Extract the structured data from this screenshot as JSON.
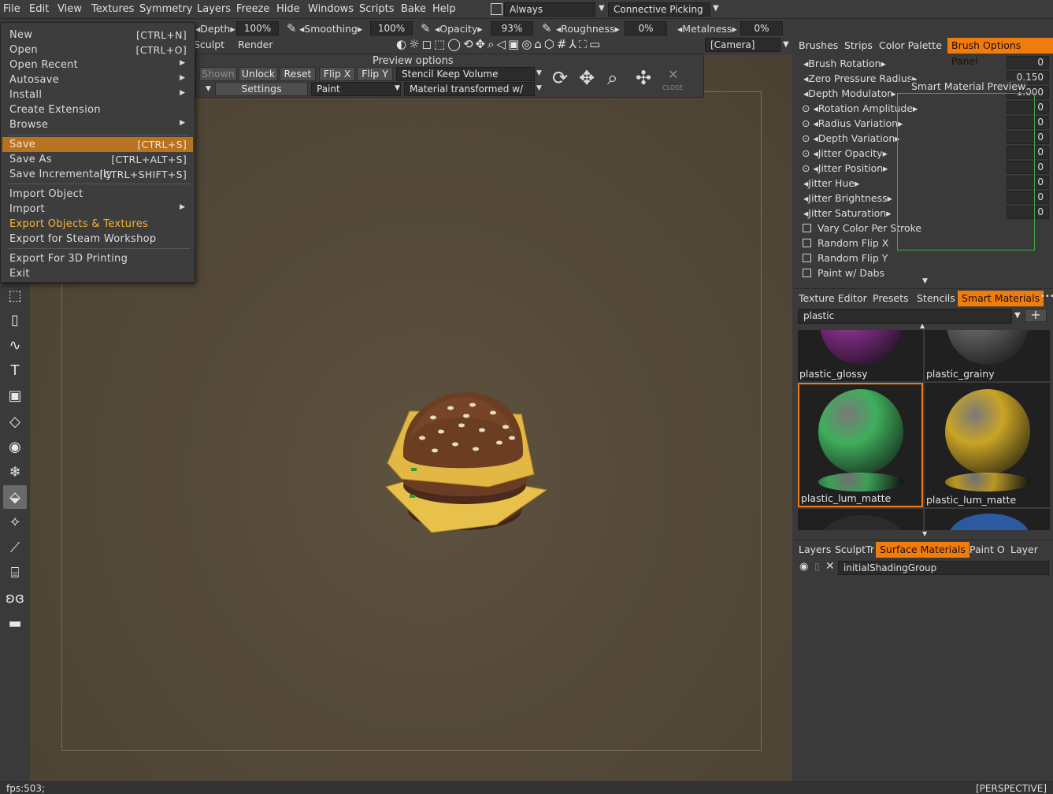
{
  "menubar": {
    "items": [
      "File",
      "Edit",
      "View",
      "Textures",
      "Symmetry",
      "Layers",
      "Freeze",
      "Hide",
      "Windows",
      "Scripts",
      "Bake",
      "Help"
    ],
    "always_label": "Always",
    "picking_label": "Connective Picking"
  },
  "toolbar": {
    "depth_label": "Depth",
    "depth_value": "100%",
    "smoothing_label": "Smoothing",
    "smoothing_value": "100%",
    "opacity_label": "Opacity",
    "opacity_value": "93%",
    "roughness_label": "Roughness",
    "roughness_value": "0%",
    "metalness_label": "Metalness",
    "metalness_value": "0%",
    "room_tabs": [
      "Sculpt",
      "Render"
    ],
    "camera_label": "[Camera]"
  },
  "file_menu": {
    "items": [
      {
        "label": "New",
        "shortcut": "[CTRL+N]"
      },
      {
        "label": "Open",
        "shortcut": "[CTRL+O]"
      },
      {
        "label": "Open Recent",
        "shortcut": ""
      },
      {
        "label": "Autosave",
        "shortcut": ""
      },
      {
        "label": "Install",
        "shortcut": ""
      },
      {
        "label": "Create Extension",
        "shortcut": ""
      },
      {
        "label": "Browse",
        "shortcut": ""
      },
      {
        "label": "Save",
        "shortcut": "[CTRL+S]"
      },
      {
        "label": "Save As",
        "shortcut": "[CTRL+ALT+S]"
      },
      {
        "label": "Save Incrementally",
        "shortcut": "[CTRL+SHIFT+S]"
      },
      {
        "label": "Import Object",
        "shortcut": ""
      },
      {
        "label": "Import",
        "shortcut": ""
      },
      {
        "label": "Export Objects & Textures",
        "shortcut": ""
      },
      {
        "label": "Export for Steam Workshop",
        "shortcut": ""
      },
      {
        "label": "Export For 3D Printing",
        "shortcut": ""
      },
      {
        "label": "Exit",
        "shortcut": ""
      }
    ]
  },
  "preview_options": {
    "title": "Preview options",
    "buttons": [
      "Shown",
      "Unlock",
      "Reset",
      "Flip X",
      "Flip Y"
    ],
    "stencil_mode": "Stencil Keep Volume",
    "settings_label": "Settings",
    "paint_label": "Paint",
    "material_mode": "Material transformed w/",
    "close_label": "CLOSE"
  },
  "brush_panel": {
    "tabs": [
      "Brushes",
      "Strips",
      "Color Palette",
      "Brush Options Panel"
    ],
    "active_tab": "Brush Options Panel",
    "smart_preview_label": "Smart Material Preview",
    "rows": [
      {
        "label": "Brush Rotation",
        "value": "0"
      },
      {
        "label": "Zero Pressure Radius",
        "value": "0.150"
      },
      {
        "label": "Depth Modulator",
        "value": "1.000"
      },
      {
        "label": "Rotation Amplitude",
        "value": "0"
      },
      {
        "label": "Radius Variation",
        "value": "0"
      },
      {
        "label": "Depth Variation",
        "value": "0"
      },
      {
        "label": "Jitter Opacity",
        "value": "0"
      },
      {
        "label": "Jitter Position",
        "value": "0"
      },
      {
        "label": "Jitter Hue",
        "value": "0"
      },
      {
        "label": "Jitter Brightness",
        "value": "0"
      },
      {
        "label": "Jitter Saturation",
        "value": "0"
      }
    ],
    "checkboxes": [
      "Vary Color Per Stroke",
      "Random Flip X",
      "Random Flip Y",
      "Paint w/ Dabs"
    ]
  },
  "smart_materials": {
    "tabs": [
      "Texture Editor",
      "Presets",
      "Stencils",
      "Smart Materials"
    ],
    "active_tab": "Smart Materials",
    "search_value": "plastic",
    "items": [
      {
        "name": "plastic_glossy",
        "color": "#7a2a7e"
      },
      {
        "name": "plastic_grainy",
        "color": "#5a5a5a"
      },
      {
        "name": "plastic_lum_matte",
        "color": "#3fae5c"
      },
      {
        "name": "plastic_lum_matte",
        "color": "#c9a425"
      }
    ]
  },
  "layers_panel": {
    "tabs": [
      "Layers",
      "SculptTr",
      "Surface Materials",
      "Paint O",
      "Layer Bl"
    ],
    "active_tab": "Surface Materials",
    "rows": [
      "initialShadingGroup"
    ]
  },
  "status": {
    "fps": "fps:503;",
    "view_mode": "[PERSPECTIVE]"
  }
}
